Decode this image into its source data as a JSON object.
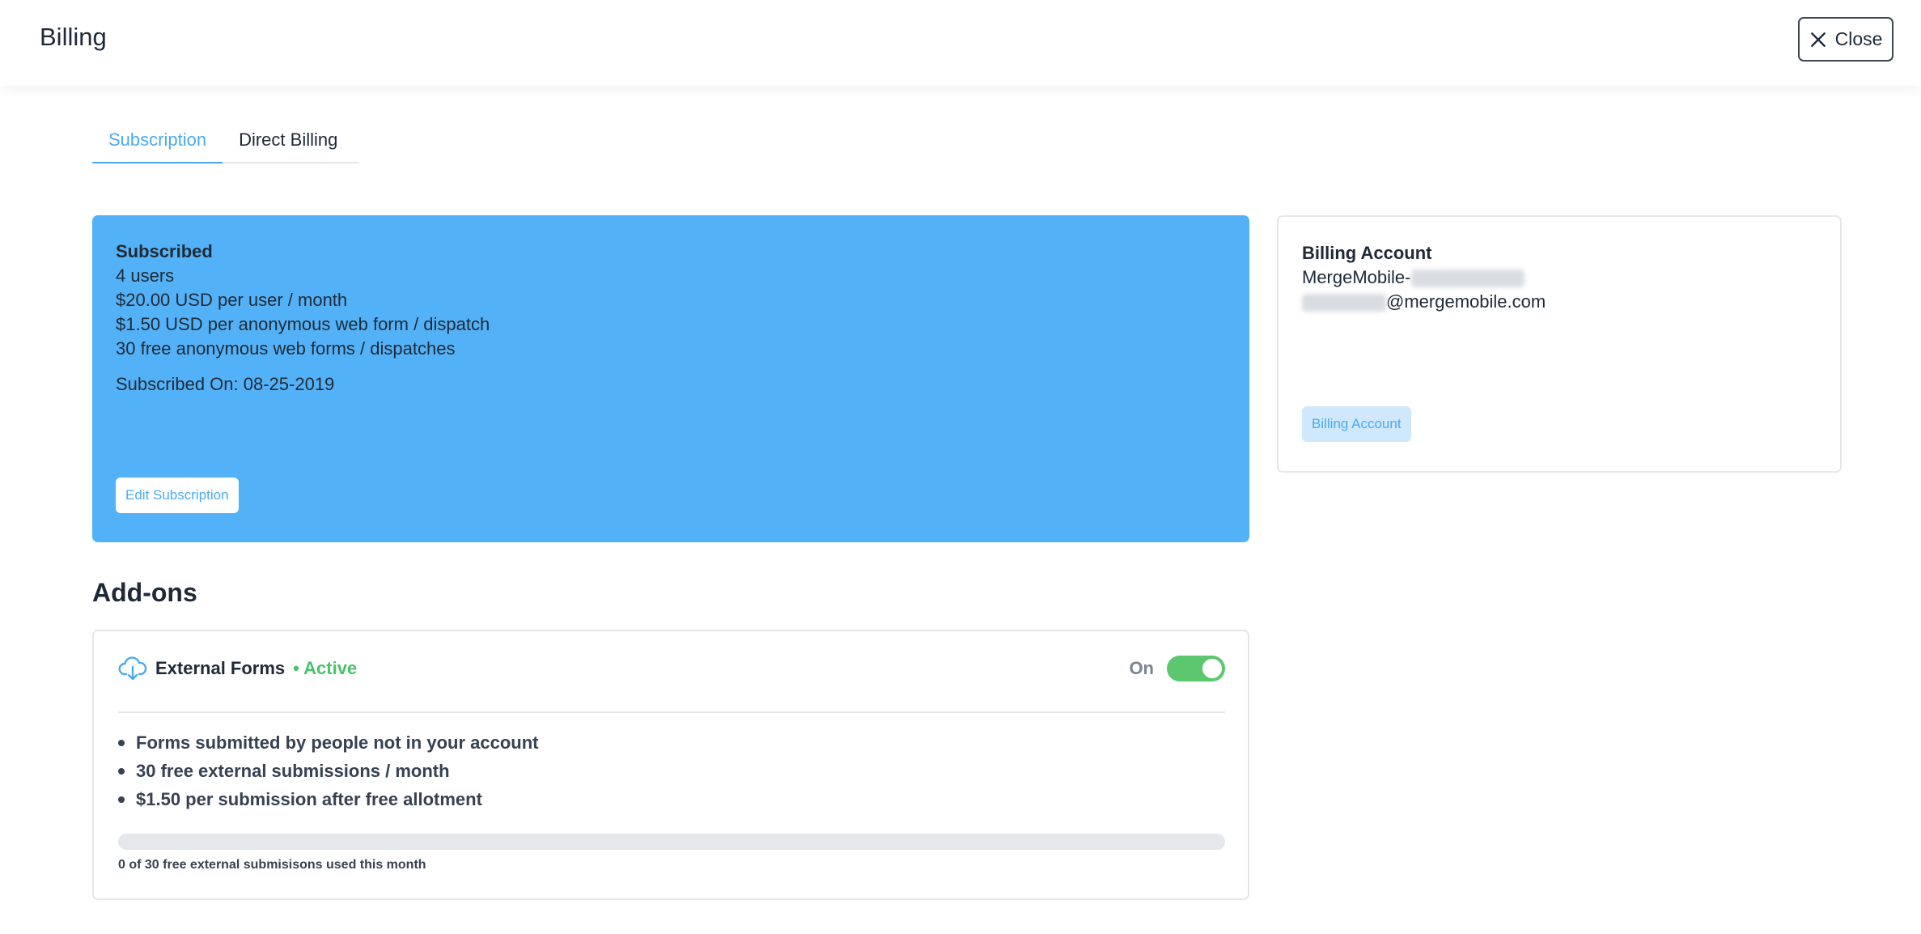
{
  "header": {
    "title": "Billing",
    "close_label": "Close"
  },
  "tabs": [
    {
      "label": "Subscription",
      "active": true
    },
    {
      "label": "Direct Billing",
      "active": false
    }
  ],
  "subscription": {
    "title": "Subscribed",
    "lines": [
      "4 users",
      "$20.00 USD per user / month",
      "$1.50 USD per anonymous web form / dispatch",
      "30 free anonymous web forms / dispatches"
    ],
    "subscribed_on": "Subscribed On: 08-25-2019",
    "edit_label": "Edit Subscription",
    "card_color": "#53b2f7"
  },
  "billing_account": {
    "title": "Billing Account",
    "name_prefix": "MergeMobile-",
    "email_suffix": "@mergemobile.com",
    "button_label": "Billing Account"
  },
  "addons": {
    "heading": "Add-ons",
    "items": [
      {
        "icon": "cloud-download-icon",
        "name": "External Forms",
        "status": "• Active",
        "status_color": "#49c26a",
        "toggle_label": "On",
        "toggle_on": true,
        "features": [
          "Forms submitted by people not in your account",
          "30 free external submissions / month",
          "$1.50 per submission after free allotment"
        ],
        "usage_fraction": 0,
        "usage_text": "0 of 30 free external submisisons used this month"
      }
    ]
  },
  "colors": {
    "accent": "#4aaaf0",
    "success": "#5cc76f"
  }
}
